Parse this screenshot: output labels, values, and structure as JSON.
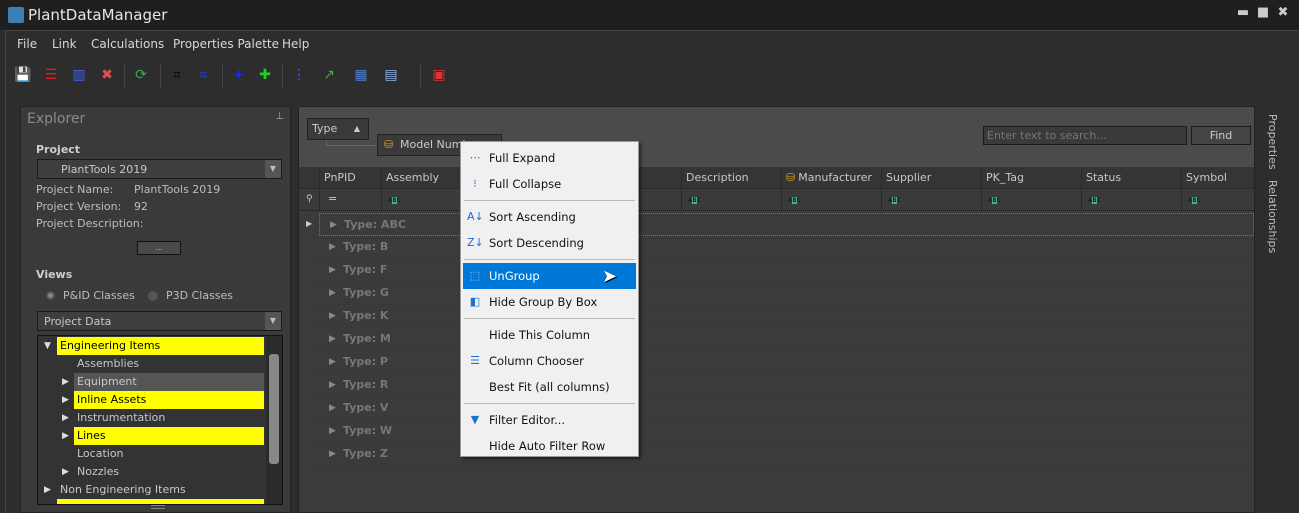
{
  "window": {
    "title": "PlantDataManager",
    "controls": [
      "▬",
      "■",
      "✖"
    ]
  },
  "menu": [
    "File",
    "Link",
    "Calculations",
    "Properties Palette",
    "Help"
  ],
  "toolbar": [
    {
      "icon": "save-icon",
      "glyph": "💾",
      "color": "#5a5ad0"
    },
    {
      "icon": "rows-icon",
      "glyph": "☰",
      "color": "#e02020"
    },
    {
      "icon": "columns-icon",
      "glyph": "▥",
      "color": "#4060ff"
    },
    {
      "icon": "delete-icon",
      "glyph": "✖",
      "color": "#e05050"
    },
    {
      "icon": "refresh-icon",
      "glyph": "⟳",
      "color": "#2fb050"
    },
    {
      "icon": "find-icon",
      "glyph": "⌗",
      "color": "#000"
    },
    {
      "icon": "find-replace-icon",
      "glyph": "⌗",
      "color": "#2040ff"
    },
    {
      "icon": "add-icon",
      "glyph": "+",
      "color": "#1030ff"
    },
    {
      "icon": "add-item-icon",
      "glyph": "✚",
      "color": "#20d020"
    },
    {
      "icon": "link-icon",
      "glyph": "⋮",
      "color": "#4060ff"
    },
    {
      "icon": "export-icon",
      "glyph": "↗",
      "color": "#40b040"
    },
    {
      "icon": "import-icon",
      "glyph": "▦",
      "color": "#4a80d0"
    },
    {
      "icon": "layout-icon",
      "glyph": "▤",
      "color": "#8ab0e0"
    },
    {
      "icon": "close-document-icon",
      "glyph": "▣",
      "color": "#e03030"
    }
  ],
  "explorer": {
    "title": "Explorer",
    "project_label": "Project",
    "project_value": "PlantTools 2019",
    "info": [
      {
        "k": "Project Name:",
        "v": "PlantTools 2019"
      },
      {
        "k": "Project Version:",
        "v": "92"
      },
      {
        "k": "Project Description:",
        "v": ""
      }
    ],
    "more_button": "...",
    "views_label": "Views",
    "radio_pid": "P&ID Classes",
    "radio_p3d": "P3D Classes",
    "data_combo": "Project Data",
    "tree": [
      {
        "label": "Engineering Items",
        "level": 0,
        "state": "open",
        "hl": true
      },
      {
        "label": "Assemblies",
        "level": 1,
        "state": "none",
        "hl": false
      },
      {
        "label": "Equipment",
        "level": 1,
        "state": "closed",
        "hl": false,
        "sel": true
      },
      {
        "label": "Inline Assets",
        "level": 1,
        "state": "closed",
        "hl": true
      },
      {
        "label": "Instrumentation",
        "level": 1,
        "state": "closed",
        "hl": false
      },
      {
        "label": "Lines",
        "level": 1,
        "state": "closed",
        "hl": true
      },
      {
        "label": "Location",
        "level": 1,
        "state": "none",
        "hl": false
      },
      {
        "label": "Nozzles",
        "level": 1,
        "state": "closed",
        "hl": false
      },
      {
        "label": "Non Engineering Items",
        "level": 0,
        "state": "closed",
        "hl": false
      }
    ]
  },
  "grid": {
    "group_chip": "Type",
    "group_chip2": "Model Number",
    "search_placeholder": "Enter text to search...",
    "find_button": "Find",
    "columns": [
      "PnPID",
      "Assembly",
      "Description",
      "Manufacturer",
      "Supplier",
      "PK_Tag",
      "Status",
      "Symbol Name"
    ],
    "groups": [
      "Type: ABC",
      "Type: B",
      "Type: F",
      "Type: G",
      "Type: K",
      "Type: M",
      "Type: P",
      "Type: R",
      "Type: V",
      "Type: W",
      "Type: Z"
    ]
  },
  "context_menu": [
    {
      "label": "Full Expand",
      "icon": "full-expand-icon",
      "glyph": "⋯"
    },
    {
      "label": "Full Collapse",
      "icon": "full-collapse-icon",
      "glyph": "⁝"
    },
    {
      "sep": true
    },
    {
      "label": "Sort Ascending",
      "icon": "sort-ascending-icon",
      "glyph": "A↓"
    },
    {
      "label": "Sort Descending",
      "icon": "sort-descending-icon",
      "glyph": "Z↓"
    },
    {
      "sep": true
    },
    {
      "label": "UnGroup",
      "icon": "ungroup-icon",
      "glyph": "⬚",
      "active": true
    },
    {
      "label": "Hide Group By Box",
      "icon": "hide-group-box-icon",
      "glyph": "◧"
    },
    {
      "sep": true
    },
    {
      "label": "Hide This Column",
      "icon": "",
      "glyph": ""
    },
    {
      "label": "Column Chooser",
      "icon": "column-chooser-icon",
      "glyph": "☰"
    },
    {
      "label": "Best Fit (all columns)",
      "icon": "",
      "glyph": ""
    },
    {
      "sep": true
    },
    {
      "label": "Filter Editor...",
      "icon": "filter-icon",
      "glyph": "▼"
    },
    {
      "label": "Hide Auto Filter Row",
      "icon": "",
      "glyph": ""
    }
  ],
  "side_tabs": [
    "Properties",
    "Relationships"
  ]
}
